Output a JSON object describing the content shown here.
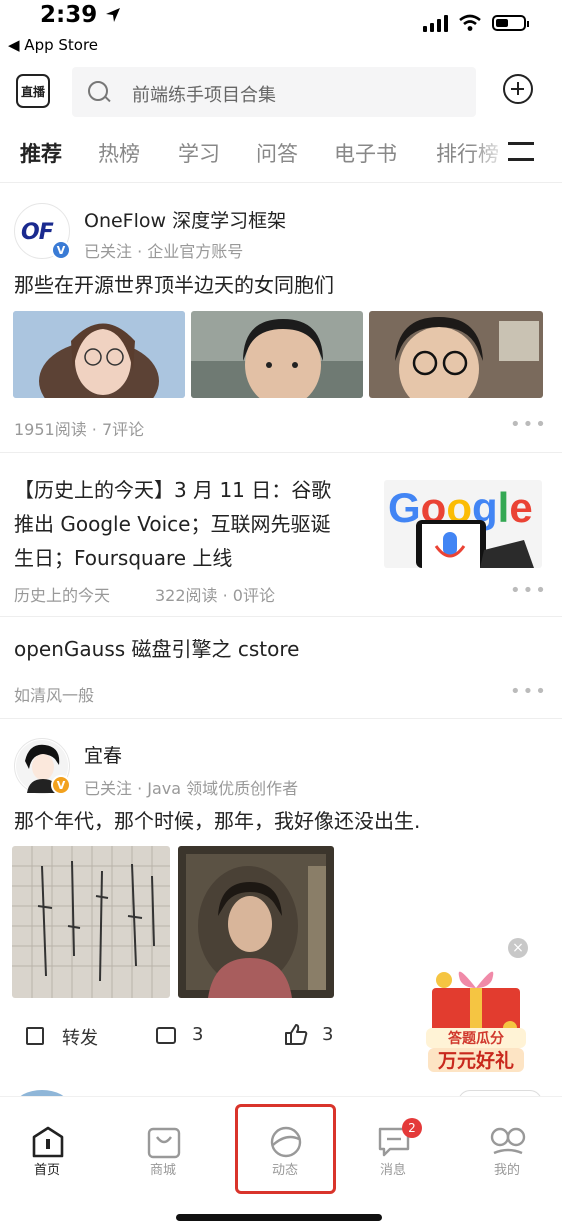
{
  "status_bar": {
    "time": "2:39",
    "back_app": "◀ App Store"
  },
  "top_bar": {
    "live_label": "直播",
    "search_placeholder": "前端练手项目合集"
  },
  "tabs": [
    "推荐",
    "热榜",
    "学习",
    "问答",
    "电子书",
    "排行榜"
  ],
  "feed": {
    "post1": {
      "author": "OneFlow 深度学习框架",
      "author_meta": "已关注 · 企业官方账号",
      "avatar_text": "OF",
      "verified_badge": "V",
      "title": "那些在开源世界顶半边天的女同胞们",
      "stats": "1951阅读 · 7评论"
    },
    "post2": {
      "title_line1": "【历史上的今天】3 月 11 日：谷歌",
      "title_line2": "推出 Google Voice；互联网先驱诞",
      "title_line3": "生日；Foursquare 上线",
      "source": "历史上的今天",
      "stats": "322阅读 · 0评论",
      "thumb_logo": "Google"
    },
    "post3": {
      "title": "openGauss 磁盘引擎之 cstore",
      "source": "如清风一般"
    },
    "post4": {
      "author": "宜春",
      "author_meta": "已关注 · Java 领域优质创作者",
      "verified_badge": "V",
      "title": "那个年代，那个时候，那年，我好像还没出生.",
      "share_label": "转发",
      "comment_count": "3",
      "like_count": "3"
    }
  },
  "promo": {
    "line1": "答题瓜分",
    "line2": "万元好礼"
  },
  "tab_bar": {
    "items": [
      {
        "label": "首页"
      },
      {
        "label": "商城"
      },
      {
        "label": "动态"
      },
      {
        "label": "消息",
        "badge": "2"
      },
      {
        "label": "我的"
      }
    ]
  }
}
